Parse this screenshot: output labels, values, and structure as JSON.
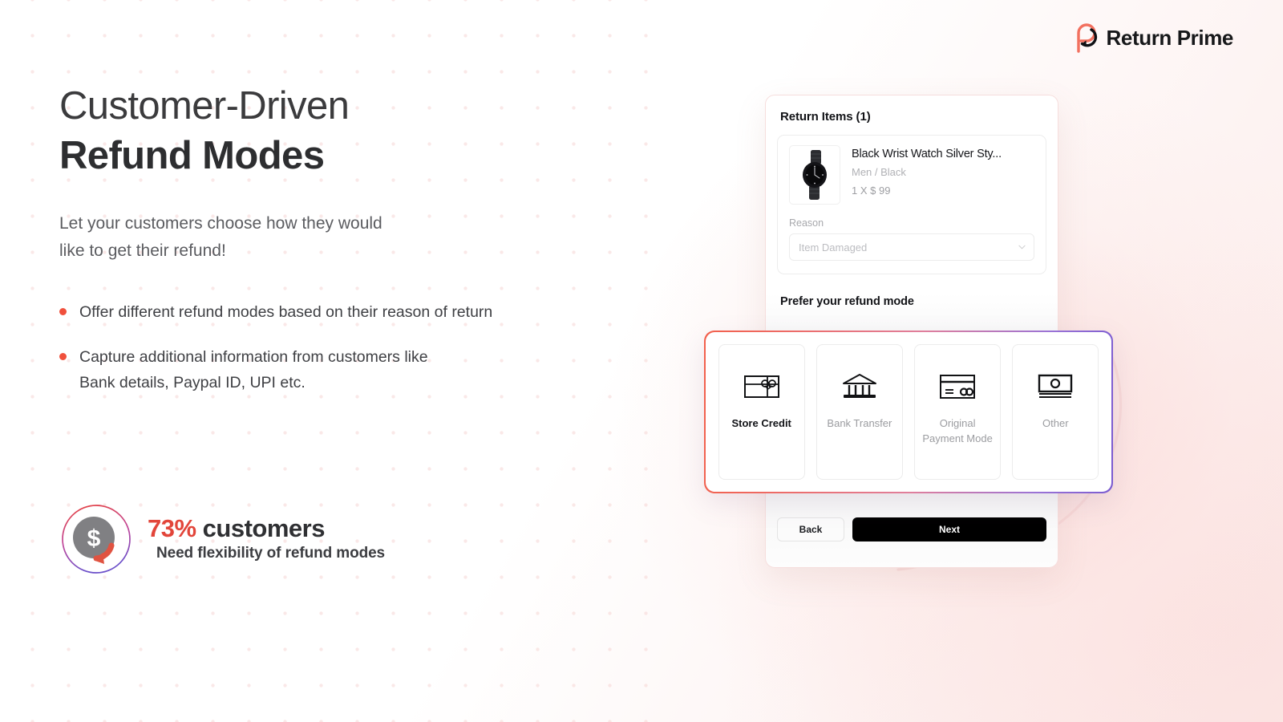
{
  "brand": {
    "name": "Return Prime",
    "logo_icon": "return-prime-logo-icon",
    "accent_coral": "#f0503c",
    "accent_purple": "#7a5bd0"
  },
  "hero": {
    "title_line1": "Customer-Driven",
    "title_line2": "Refund Modes",
    "subtitle_line1": "Let your customers choose how they would",
    "subtitle_line2": "like to get their refund!",
    "bullets": [
      {
        "text": "Offer different refund modes based on their reason of return"
      },
      {
        "text": "Capture additional information from customers like"
      },
      {
        "text": "Bank details, Paypal ID, UPI etc."
      }
    ]
  },
  "stat": {
    "icon": "dollar-refund-icon",
    "percent": "73%",
    "headline_rest": " customers",
    "caption": "Need flexibility of refund modes"
  },
  "mock": {
    "title": "Return Items (1)",
    "item": {
      "thumbnail_icon": "black-wrist-watch-image",
      "name": "Black Wrist Watch Silver Sty...",
      "variant": "Men / Black",
      "quantity": "1 X $ 99"
    },
    "reason": {
      "label": "Reason",
      "value": "Item Damaged",
      "caret_icon": "chevron-down-icon"
    },
    "prefer_heading": "Prefer your refund mode",
    "buttons": {
      "back": "Back",
      "next": "Next"
    }
  },
  "refund_modes": [
    {
      "label": "Store Credit",
      "icon": "gift-card-icon",
      "selected": true
    },
    {
      "label": "Bank Transfer",
      "icon": "bank-icon",
      "selected": false
    },
    {
      "label": "Original Payment Mode",
      "icon": "credit-card-icon",
      "selected": false
    },
    {
      "label": "Other",
      "icon": "banknote-icon",
      "selected": false
    }
  ],
  "decor": {
    "dots": "pink-dot-pattern",
    "swoosh": "return-arrow-swoosh"
  }
}
